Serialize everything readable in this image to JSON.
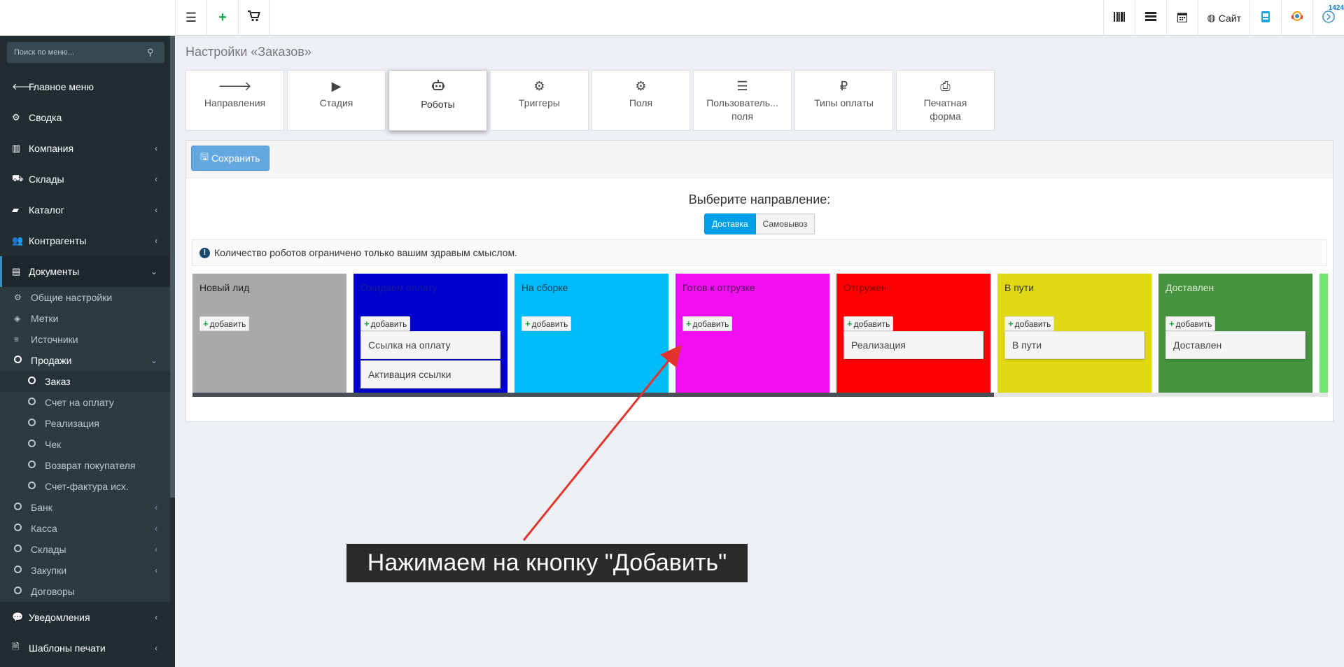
{
  "topbar": {
    "left_buttons": [
      "menu-icon",
      "plus-icon",
      "cart-icon"
    ],
    "right_buttons": [
      {
        "icon": "barcode-icon",
        "label": ""
      },
      {
        "icon": "server-icon",
        "label": ""
      },
      {
        "icon": "calendar-icon",
        "label": ""
      },
      {
        "icon": "globe-icon",
        "label": "Сайт"
      },
      {
        "icon": "app-icon",
        "label": ""
      },
      {
        "icon": "support-icon",
        "label": ""
      },
      {
        "icon": "timer-icon",
        "label": "",
        "count": "1424"
      }
    ]
  },
  "sidebar": {
    "search_placeholder": "Поиск по меню...",
    "items": [
      {
        "label": "Главное меню",
        "icon": "arrow-left-icon"
      },
      {
        "label": "Сводка",
        "icon": "gear-icon"
      },
      {
        "label": "Компания",
        "icon": "chart-icon"
      },
      {
        "label": "Склады",
        "icon": "truck-icon"
      },
      {
        "label": "Каталог",
        "icon": "folder-icon"
      },
      {
        "label": "Контрагенты",
        "icon": "users-icon"
      },
      {
        "label": "Документы",
        "icon": "document-icon"
      }
    ],
    "doc_sub": [
      {
        "label": "Общие настройки",
        "icon": "gears-icon"
      },
      {
        "label": "Метки",
        "icon": "tags-icon"
      },
      {
        "label": "Источники",
        "icon": "list-icon"
      },
      {
        "label": "Продажи",
        "icon": "circle-icon"
      }
    ],
    "sales_sub": [
      "Заказ",
      "Счет на оплату",
      "Реализация",
      "Чек",
      "Возврат покупателя",
      "Счет-фактура исх."
    ],
    "doc_sub2": [
      "Банк",
      "Касса",
      "Склады",
      "Закупки",
      "Договоры"
    ],
    "bottom": [
      {
        "label": "Уведомления",
        "icon": "comments-icon"
      },
      {
        "label": "Шаблоны печати",
        "icon": "file-icon"
      }
    ]
  },
  "page": {
    "title": "Настройки «Заказов»",
    "tabs": [
      {
        "label": "Направления",
        "icon": "arrow-right-icon"
      },
      {
        "label": "Стадия",
        "icon": "play-icon"
      },
      {
        "label": "Роботы",
        "icon": "robot-icon"
      },
      {
        "label": "Триггеры",
        "icon": "cogs-icon"
      },
      {
        "label": "Поля",
        "icon": "gear-icon"
      },
      {
        "label": "Пользователь...\nполя",
        "icon": "list-icon"
      },
      {
        "label": "Типы оплаты",
        "icon": "ruble-icon"
      },
      {
        "label": "Печатная\nформа",
        "icon": "print-icon"
      }
    ],
    "save_label": "Сохранить",
    "direction_title": "Выберите направление:",
    "direction_on": "Доставка",
    "direction_off": "Самовывоз",
    "info_text": "Количество роботов ограничено только вашим здравым смыслом.",
    "add_label": "добавить",
    "stages": [
      {
        "name": "Новый лид",
        "color": "#a9a9a9",
        "text_color": "#222",
        "robots": []
      },
      {
        "name": "Ожидаем оплату",
        "color": "#0000cc",
        "text_color": "#1a1a9a",
        "robots": [
          "Ссылка на оплату",
          "Активация ссылки"
        ]
      },
      {
        "name": "На сборке",
        "color": "#00bbf9",
        "text_color": "#1c3d4a",
        "robots": []
      },
      {
        "name": "Готов к отгрузке",
        "color": "#f00ff0",
        "text_color": "#4a1450",
        "robots": []
      },
      {
        "name": "Отгружен",
        "color": "#ff0000",
        "text_color": "#7a0b0b",
        "robots": [
          "Реализация"
        ]
      },
      {
        "name": "В пути",
        "color": "#dfd813",
        "text_color": "#333",
        "robots": [
          "В пути"
        ]
      },
      {
        "name": "Доставлен",
        "color": "#45933f",
        "text_color": "#d9f0d3",
        "robots": [
          "Доставлен"
        ]
      },
      {
        "name": "",
        "color": "#6ee86e",
        "text_color": "#333",
        "robots": []
      }
    ]
  },
  "annotation": "Нажимаем на кнопку \"Добавить\""
}
